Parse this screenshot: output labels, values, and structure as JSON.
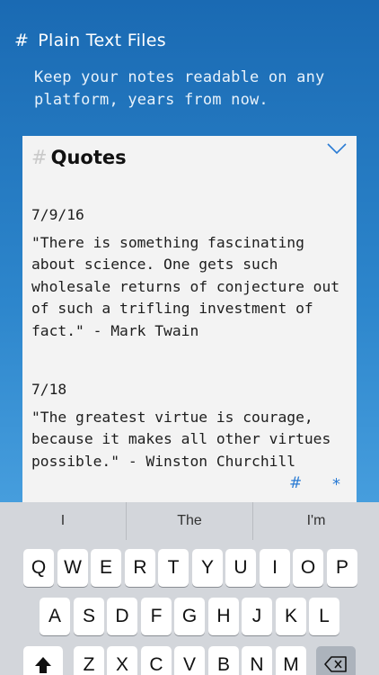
{
  "promo": {
    "hash": "#",
    "title": "Plain Text Files",
    "subtitle": "Keep your notes readable on any platform, years from now."
  },
  "note": {
    "title_hash": "#",
    "title": "Quotes",
    "entries": [
      {
        "date": "7/9/16",
        "text": "\"There is something fascinating about science. One gets such wholesale returns of conjecture out of such a trifling investment of fact.\" - Mark Twain"
      },
      {
        "date": "7/18",
        "text": "\"The greatest virtue is courage, because it makes all other virtues possible.\" - Winston Churchill"
      }
    ]
  },
  "toolbar": {
    "hash": "#",
    "star": "*"
  },
  "keyboard": {
    "suggestions": [
      "I",
      "The",
      "I'm"
    ],
    "row1": [
      "Q",
      "W",
      "E",
      "R",
      "T",
      "Y",
      "U",
      "I",
      "O",
      "P"
    ],
    "row2": [
      "A",
      "S",
      "D",
      "F",
      "G",
      "H",
      "J",
      "K",
      "L"
    ],
    "row3": [
      "Z",
      "X",
      "C",
      "V",
      "B",
      "N",
      "M"
    ],
    "icons": {
      "shift": "shift-icon",
      "backspace": "backspace-icon"
    }
  },
  "colors": {
    "accent": "#2a7bd4",
    "background_top": "#1a6ab3",
    "background_bottom": "#5cb2ec",
    "card": "#f3f3f3",
    "keyboard": "#d3d6db"
  }
}
